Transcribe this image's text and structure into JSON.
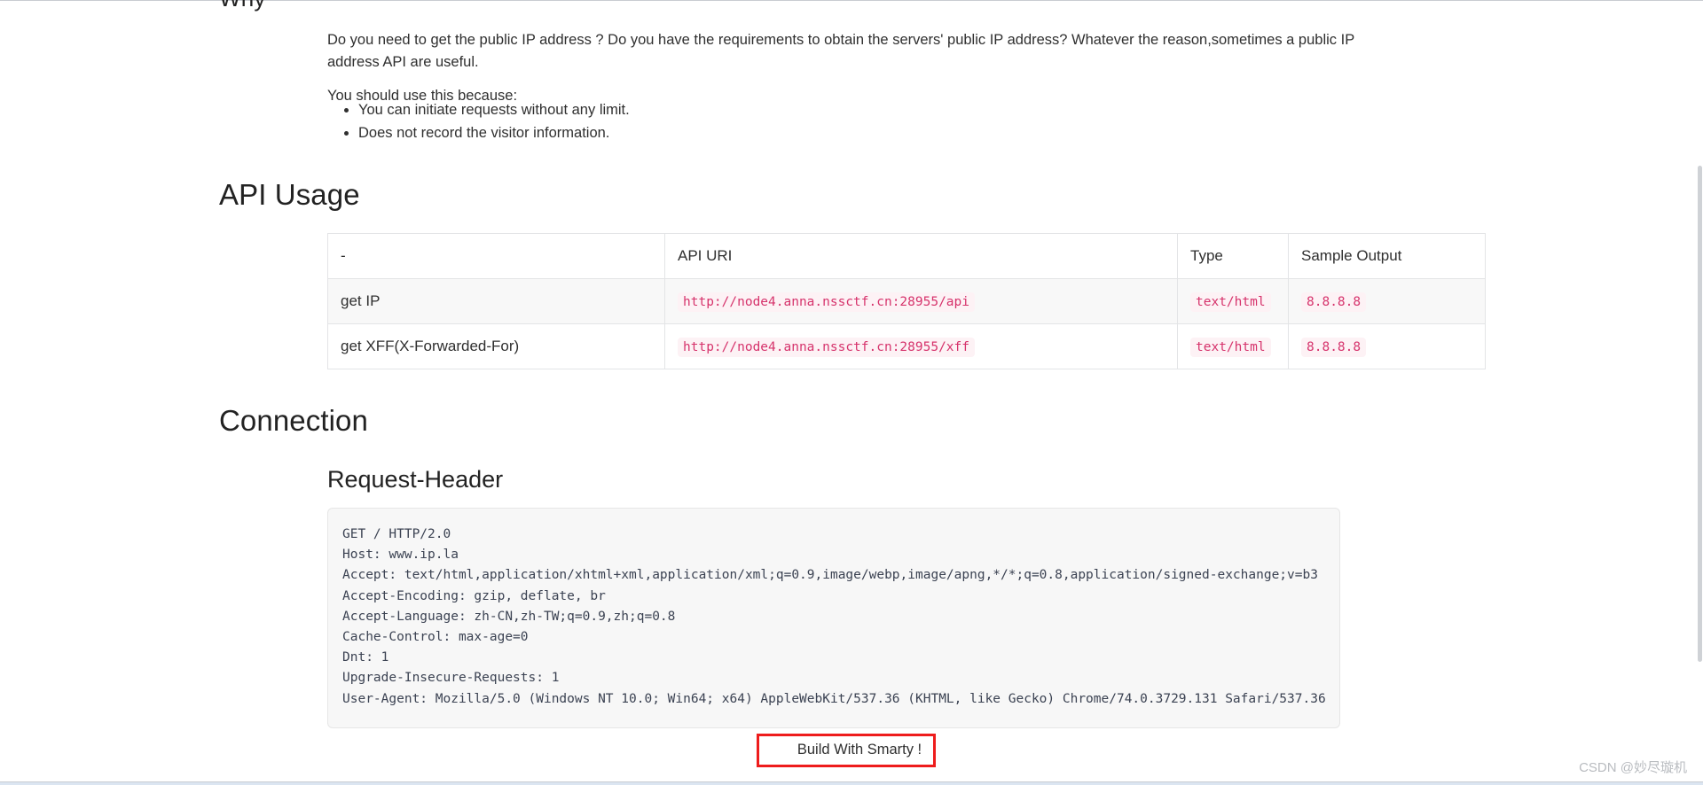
{
  "page": {
    "cut_heading": "Why",
    "watermark": "CSDN @妙尽璇机"
  },
  "intro": {
    "paragraph": "Do you need to get the public IP address ? Do you have the requirements to obtain the servers' public IP address? Whatever the reason,sometimes a public IP address API are useful.",
    "lead_in": "You should use this because:",
    "bullets": [
      "You can initiate requests without any limit.",
      "Does not record the visitor information."
    ]
  },
  "api_usage": {
    "heading": "API Usage",
    "columns": [
      "-",
      "API URI",
      "Type",
      "Sample Output"
    ],
    "rows": [
      {
        "label": "get IP",
        "uri": "http://node4.anna.nssctf.cn:28955/api",
        "type": "text/html",
        "sample": "8.8.8.8"
      },
      {
        "label": "get XFF(X-Forwarded-For)",
        "uri": "http://node4.anna.nssctf.cn:28955/xff",
        "type": "text/html",
        "sample": "8.8.8.8"
      }
    ]
  },
  "connection": {
    "heading": "Connection",
    "subheading": "Request-Header",
    "request_header": "GET / HTTP/2.0\nHost: www.ip.la\nAccept: text/html,application/xhtml+xml,application/xml;q=0.9,image/webp,image/apng,*/*;q=0.8,application/signed-exchange;v=b3\nAccept-Encoding: gzip, deflate, br\nAccept-Language: zh-CN,zh-TW;q=0.9,zh;q=0.8\nCache-Control: max-age=0\nDnt: 1\nUpgrade-Insecure-Requests: 1\nUser-Agent: Mozilla/5.0 (Windows NT 10.0; Win64; x64) AppleWebKit/537.36 (KHTML, like Gecko) Chrome/74.0.3729.131 Safari/537.36"
  },
  "footer": {
    "smarty_label": "Build With Smarty !"
  },
  "colors": {
    "code_text": "#d6336c",
    "code_bg": "#fdf2f5",
    "annotation_red": "#ee1c1c",
    "block_bg": "#f7f7f7"
  }
}
